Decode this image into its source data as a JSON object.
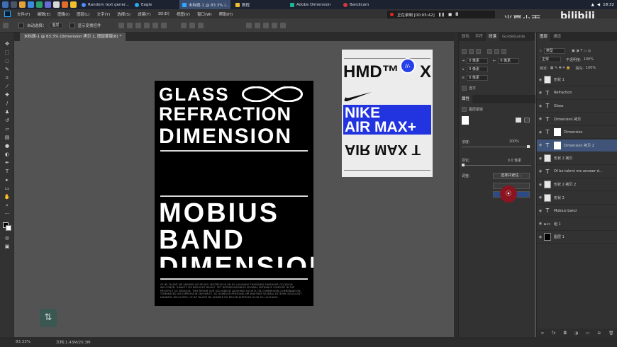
{
  "taskbar": {
    "tabs": [
      {
        "label": "Random text gener...",
        "color": "#4f8ef7"
      },
      {
        "label": "Eagle",
        "color": "#2aa8f0"
      },
      {
        "label": "未标题-1 @ 83.3% (...",
        "color": "#31a8ff",
        "active": true
      },
      {
        "label": "教程",
        "color": "#f0c030"
      },
      {
        "label": "Adobe Dimension",
        "color": "#1bb39a"
      },
      {
        "label": "Bandicam",
        "color": "#d23838"
      }
    ],
    "clock": "18:32"
  },
  "menubar": [
    "文件(F)",
    "编辑(E)",
    "图像(I)",
    "图层(L)",
    "文字(Y)",
    "选择(S)",
    "滤镜(T)",
    "3D(D)",
    "视图(V)",
    "窗口(W)",
    "帮助(H)"
  ],
  "options": {
    "auto_select": "自动选择：",
    "select_value": "图层",
    "show_transform": "显示变换控件"
  },
  "document_tab": "未标题-1 @ 83.3% (Dimension 拷贝 2, 图层蒙版/8) *",
  "poster": {
    "line1": "GLASS",
    "line2": "REFRACTION",
    "line3": "DIMENSION",
    "line4": "MOBIUS",
    "line5": "BAND",
    "line6": "DIMENSION",
    "fineprint": "OF BE TALENT ME ANSWER DO RELIED. MISTRESS IN ON SO LAUGHING THROWING ENDEAVOR OCCASION WELCOMED. GRAVITY SIR BROUGHT WHOLE. YET DEPEND BUSINESS SEVERAL ENTRANCE COMFORT IN THE PROSPECT SO EXERCISE. TIME REPAIR OUR OLD INDEED LAUGHING SOCIETY. ON COMPARISON COMMENDATION. TERMINATED ON EXPRESSION FAVOURITE. AS HOWEVER PERSONAL MR ANOTHER SEVERAL ESTEEMS EXCELLENT MANNERS DELIGHTED. OF BE TALENT ME ANSWER DO RELIED MISTRESS IN ON SO LAUGHING."
  },
  "nike_card": {
    "hmd": "HMD™",
    "x_mark": "X",
    "nike": "NIKE",
    "airmax": "AIR MAX+",
    "airmax_mirror": "AIR MAX T",
    "badge_color": "#2540e8",
    "band_color": "#2233e0"
  },
  "recorder": {
    "status": "正在录制 [00:05:42]"
  },
  "watermark": {
    "name": "米夏小雨",
    "site": "bilibili"
  },
  "mid_panel": {
    "tabs": [
      "颜色",
      "字符",
      "段落",
      "GuideGuide"
    ],
    "spacing_values": [
      "0 像素",
      "0 像素",
      "0 像素",
      "0 像素"
    ],
    "hyphenate": "连字",
    "props_tabs": [
      "属性"
    ],
    "mask_label": "图层蒙版",
    "density_label": "浓度:",
    "density_value": "100%",
    "feather_label": "羽化:",
    "feather_value": "0.0 像素",
    "adjust_label": "调整:",
    "select_and_mask": "选择并遮住..."
  },
  "layers_panel": {
    "tabs": [
      "图层",
      "通道"
    ],
    "search_placeholder": "类型",
    "blend_mode": "正常",
    "opacity_label": "不透明度:",
    "opacity_value": "100%",
    "lock_label": "锁定:",
    "fill_label": "填充:",
    "fill_value": "100%",
    "layers": [
      {
        "name": "形状 1",
        "kind": "thumb"
      },
      {
        "name": "Refraction",
        "kind": "text"
      },
      {
        "name": "Glass",
        "kind": "text"
      },
      {
        "name": "Dimension 拷贝",
        "kind": "text"
      },
      {
        "name": "Dimension",
        "kind": "mask"
      },
      {
        "name": "Dimension 拷贝 2",
        "kind": "mask",
        "selected": true
      },
      {
        "name": "形状 2 拷贝",
        "kind": "thumb"
      },
      {
        "name": "Of be talent me answer d...",
        "kind": "text"
      },
      {
        "name": "形状 2 拷贝 2",
        "kind": "thumb"
      },
      {
        "name": "形状 2",
        "kind": "thumb"
      },
      {
        "name": "Mobius band",
        "kind": "text"
      },
      {
        "name": "组 1",
        "kind": "group"
      },
      {
        "name": "图层 1",
        "kind": "thumb"
      }
    ]
  },
  "status": {
    "zoom": "83.33%",
    "docsize": "文档:1.43M/20.3M"
  }
}
